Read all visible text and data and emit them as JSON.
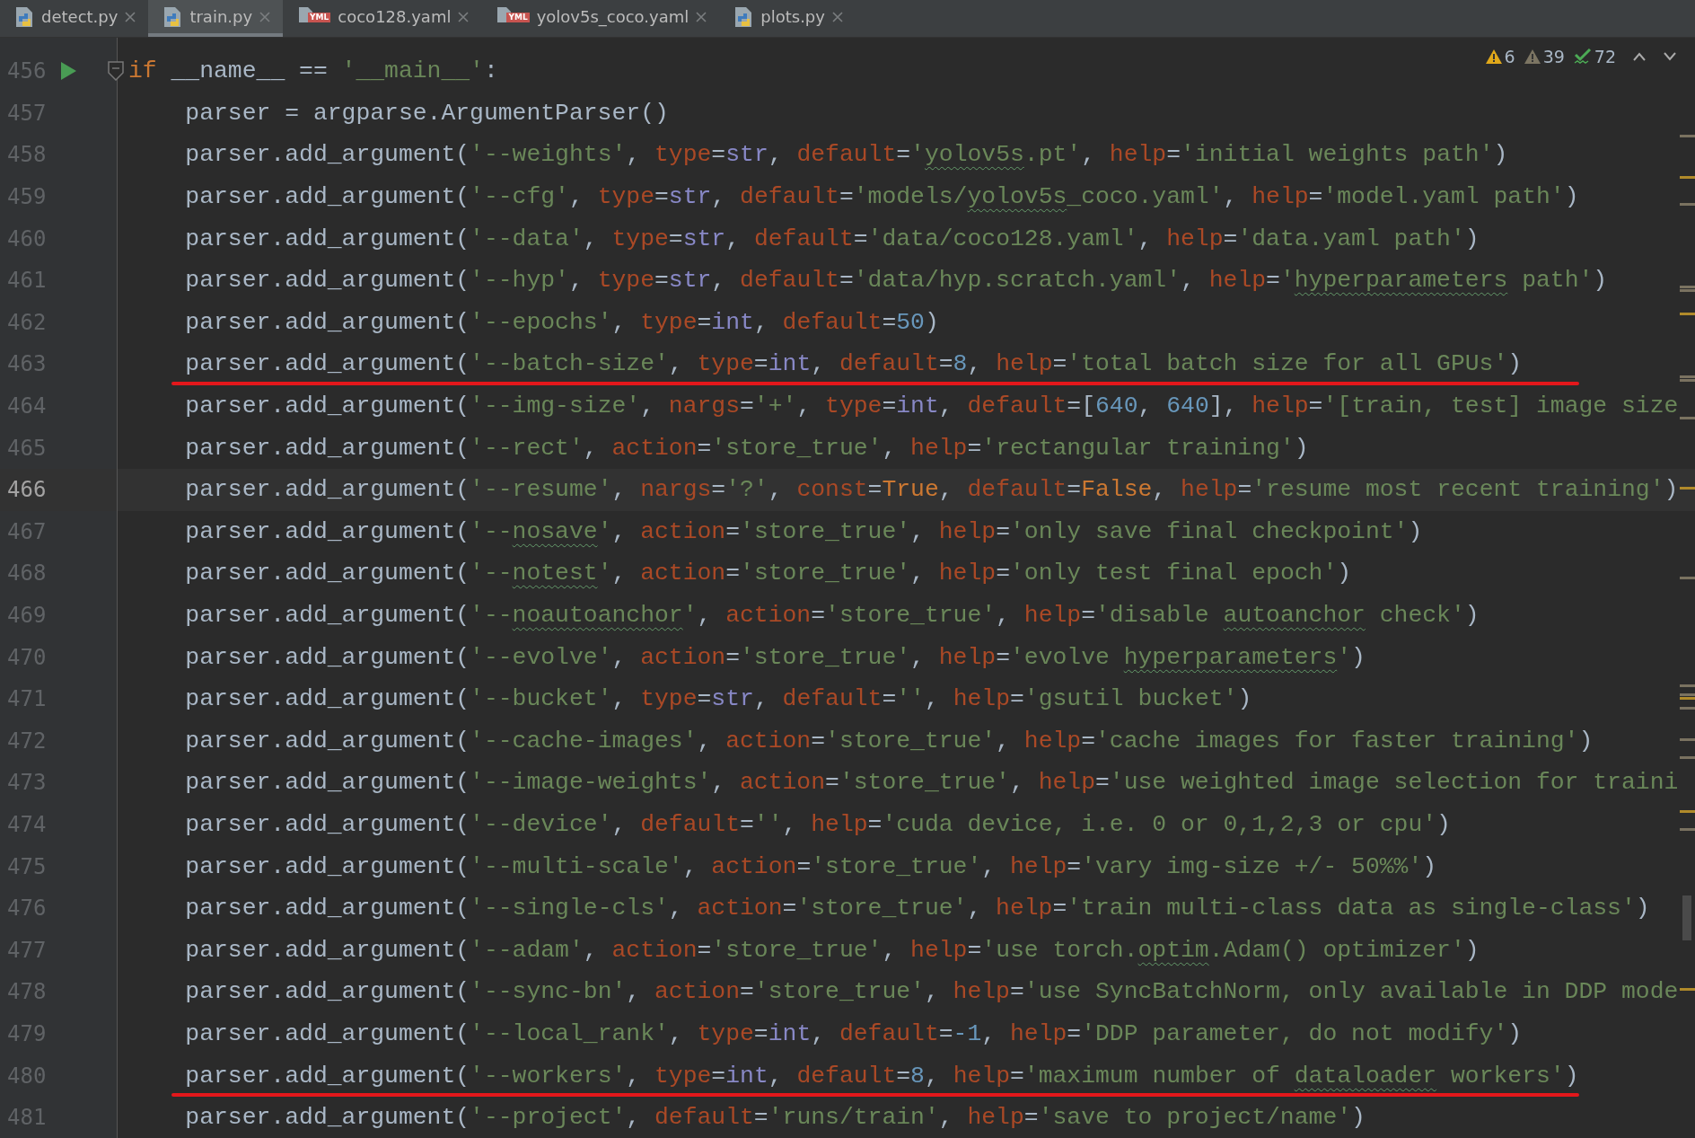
{
  "tabs": [
    {
      "label": "detect.py",
      "kind": "python",
      "selected": false
    },
    {
      "label": "train.py",
      "kind": "python",
      "selected": true
    },
    {
      "label": "coco128.yaml",
      "kind": "yaml",
      "badge": "YML",
      "selected": false
    },
    {
      "label": "yolov5s_coco.yaml",
      "kind": "yaml",
      "badge": "YML",
      "selected": false
    },
    {
      "label": "plots.py",
      "kind": "python",
      "selected": false
    }
  ],
  "inspections": [
    {
      "kind": "warning",
      "count": "6"
    },
    {
      "kind": "weak",
      "count": "39"
    },
    {
      "kind": "typo",
      "count": "72"
    }
  ],
  "lines": [
    {
      "number": "456",
      "run": true,
      "fold": true,
      "tokens": [
        {
          "kind": "k",
          "text": "if"
        },
        {
          "kind": "p",
          "text": " __name__ == "
        },
        {
          "kind": "s",
          "text": "'__main__'"
        },
        {
          "kind": "p",
          "text": ":"
        }
      ]
    },
    {
      "number": "457",
      "tokens": [
        {
          "kind": "p",
          "text": "    parser = argparse.ArgumentParser()"
        }
      ]
    },
    {
      "number": "458",
      "tokens": [
        {
          "kind": "p",
          "text": "    parser.add_argument("
        },
        {
          "kind": "s",
          "text": "'--weights'"
        },
        {
          "kind": "p",
          "text": ", "
        },
        {
          "kind": "a",
          "text": "type"
        },
        {
          "kind": "p",
          "text": "="
        },
        {
          "kind": "b",
          "text": "str"
        },
        {
          "kind": "p",
          "text": ", "
        },
        {
          "kind": "a",
          "text": "default"
        },
        {
          "kind": "p",
          "text": "="
        },
        {
          "kind": "s",
          "text": "'"
        },
        {
          "kind": "s",
          "text": "yolov5s",
          "typo": true
        },
        {
          "kind": "s",
          "text": ".pt'"
        },
        {
          "kind": "p",
          "text": ", "
        },
        {
          "kind": "a",
          "text": "help"
        },
        {
          "kind": "p",
          "text": "="
        },
        {
          "kind": "s",
          "text": "'initial weights path'"
        },
        {
          "kind": "p",
          "text": ")"
        }
      ]
    },
    {
      "number": "459",
      "tokens": [
        {
          "kind": "p",
          "text": "    parser.add_argument("
        },
        {
          "kind": "s",
          "text": "'--cfg'"
        },
        {
          "kind": "p",
          "text": ", "
        },
        {
          "kind": "a",
          "text": "type"
        },
        {
          "kind": "p",
          "text": "="
        },
        {
          "kind": "b",
          "text": "str"
        },
        {
          "kind": "p",
          "text": ", "
        },
        {
          "kind": "a",
          "text": "default"
        },
        {
          "kind": "p",
          "text": "="
        },
        {
          "kind": "s",
          "text": "'models/"
        },
        {
          "kind": "s",
          "text": "yolov5s",
          "typo": true
        },
        {
          "kind": "s",
          "text": "_coco.yaml'"
        },
        {
          "kind": "p",
          "text": ", "
        },
        {
          "kind": "a",
          "text": "help"
        },
        {
          "kind": "p",
          "text": "="
        },
        {
          "kind": "s",
          "text": "'model.yaml path'"
        },
        {
          "kind": "p",
          "text": ")"
        }
      ]
    },
    {
      "number": "460",
      "tokens": [
        {
          "kind": "p",
          "text": "    parser.add_argument("
        },
        {
          "kind": "s",
          "text": "'--data'"
        },
        {
          "kind": "p",
          "text": ", "
        },
        {
          "kind": "a",
          "text": "type"
        },
        {
          "kind": "p",
          "text": "="
        },
        {
          "kind": "b",
          "text": "str"
        },
        {
          "kind": "p",
          "text": ", "
        },
        {
          "kind": "a",
          "text": "default"
        },
        {
          "kind": "p",
          "text": "="
        },
        {
          "kind": "s",
          "text": "'data/coco128.yaml'"
        },
        {
          "kind": "p",
          "text": ", "
        },
        {
          "kind": "a",
          "text": "help"
        },
        {
          "kind": "p",
          "text": "="
        },
        {
          "kind": "s",
          "text": "'data.yaml path'"
        },
        {
          "kind": "p",
          "text": ")"
        }
      ]
    },
    {
      "number": "461",
      "tokens": [
        {
          "kind": "p",
          "text": "    parser.add_argument("
        },
        {
          "kind": "s",
          "text": "'--hyp'"
        },
        {
          "kind": "p",
          "text": ", "
        },
        {
          "kind": "a",
          "text": "type"
        },
        {
          "kind": "p",
          "text": "="
        },
        {
          "kind": "b",
          "text": "str"
        },
        {
          "kind": "p",
          "text": ", "
        },
        {
          "kind": "a",
          "text": "default"
        },
        {
          "kind": "p",
          "text": "="
        },
        {
          "kind": "s",
          "text": "'data/hyp.scratch.yaml'"
        },
        {
          "kind": "p",
          "text": ", "
        },
        {
          "kind": "a",
          "text": "help"
        },
        {
          "kind": "p",
          "text": "="
        },
        {
          "kind": "s",
          "text": "'"
        },
        {
          "kind": "s",
          "text": "hyperparameters",
          "typo": true
        },
        {
          "kind": "s",
          "text": " path'"
        },
        {
          "kind": "p",
          "text": ")"
        }
      ]
    },
    {
      "number": "462",
      "tokens": [
        {
          "kind": "p",
          "text": "    parser.add_argument("
        },
        {
          "kind": "s",
          "text": "'--epochs'"
        },
        {
          "kind": "p",
          "text": ", "
        },
        {
          "kind": "a",
          "text": "type"
        },
        {
          "kind": "p",
          "text": "="
        },
        {
          "kind": "b",
          "text": "int"
        },
        {
          "kind": "p",
          "text": ", "
        },
        {
          "kind": "a",
          "text": "default"
        },
        {
          "kind": "p",
          "text": "="
        },
        {
          "kind": "n",
          "text": "50"
        },
        {
          "kind": "p",
          "text": ")"
        }
      ]
    },
    {
      "number": "463",
      "marked": true,
      "tokens": [
        {
          "kind": "p",
          "text": "    parser.add_argument("
        },
        {
          "kind": "s",
          "text": "'--batch-size'"
        },
        {
          "kind": "p",
          "text": ", "
        },
        {
          "kind": "a",
          "text": "type"
        },
        {
          "kind": "p",
          "text": "="
        },
        {
          "kind": "b",
          "text": "int"
        },
        {
          "kind": "p",
          "text": ", "
        },
        {
          "kind": "a",
          "text": "default"
        },
        {
          "kind": "p",
          "text": "="
        },
        {
          "kind": "n",
          "text": "8"
        },
        {
          "kind": "p",
          "text": ", "
        },
        {
          "kind": "a",
          "text": "help"
        },
        {
          "kind": "p",
          "text": "="
        },
        {
          "kind": "s",
          "text": "'total batch size for all GPUs'"
        },
        {
          "kind": "p",
          "text": ")"
        }
      ]
    },
    {
      "number": "464",
      "tokens": [
        {
          "kind": "p",
          "text": "    parser.add_argument("
        },
        {
          "kind": "s",
          "text": "'--img-size'"
        },
        {
          "kind": "p",
          "text": ", "
        },
        {
          "kind": "a",
          "text": "nargs"
        },
        {
          "kind": "p",
          "text": "="
        },
        {
          "kind": "s",
          "text": "'+'"
        },
        {
          "kind": "p",
          "text": ", "
        },
        {
          "kind": "a",
          "text": "type"
        },
        {
          "kind": "p",
          "text": "="
        },
        {
          "kind": "b",
          "text": "int"
        },
        {
          "kind": "p",
          "text": ", "
        },
        {
          "kind": "a",
          "text": "default"
        },
        {
          "kind": "p",
          "text": "=["
        },
        {
          "kind": "n",
          "text": "640"
        },
        {
          "kind": "p",
          "text": ", "
        },
        {
          "kind": "n",
          "text": "640"
        },
        {
          "kind": "p",
          "text": "], "
        },
        {
          "kind": "a",
          "text": "help"
        },
        {
          "kind": "p",
          "text": "="
        },
        {
          "kind": "s",
          "text": "'[train, test] image size"
        }
      ]
    },
    {
      "number": "465",
      "tokens": [
        {
          "kind": "p",
          "text": "    parser.add_argument("
        },
        {
          "kind": "s",
          "text": "'--rect'"
        },
        {
          "kind": "p",
          "text": ", "
        },
        {
          "kind": "a",
          "text": "action"
        },
        {
          "kind": "p",
          "text": "="
        },
        {
          "kind": "s",
          "text": "'store_true'"
        },
        {
          "kind": "p",
          "text": ", "
        },
        {
          "kind": "a",
          "text": "help"
        },
        {
          "kind": "p",
          "text": "="
        },
        {
          "kind": "s",
          "text": "'rectangular training'"
        },
        {
          "kind": "p",
          "text": ")"
        }
      ]
    },
    {
      "number": "466",
      "current": true,
      "tokens": [
        {
          "kind": "p",
          "text": "    parser.add_argument("
        },
        {
          "kind": "s",
          "text": "'--resume'"
        },
        {
          "kind": "p",
          "text": ", "
        },
        {
          "kind": "a",
          "text": "nargs"
        },
        {
          "kind": "p",
          "text": "="
        },
        {
          "kind": "s",
          "text": "'?'"
        },
        {
          "kind": "p",
          "text": ", "
        },
        {
          "kind": "a",
          "text": "const"
        },
        {
          "kind": "p",
          "text": "="
        },
        {
          "kind": "k",
          "text": "True"
        },
        {
          "kind": "p",
          "text": ", "
        },
        {
          "kind": "a",
          "text": "default"
        },
        {
          "kind": "p",
          "text": "="
        },
        {
          "kind": "k",
          "text": "False"
        },
        {
          "kind": "p",
          "text": ", "
        },
        {
          "kind": "a",
          "text": "help"
        },
        {
          "kind": "p",
          "text": "="
        },
        {
          "kind": "s",
          "text": "'resume most recent training'"
        },
        {
          "kind": "p",
          "text": ")"
        }
      ]
    },
    {
      "number": "467",
      "tokens": [
        {
          "kind": "p",
          "text": "    parser.add_argument("
        },
        {
          "kind": "s",
          "text": "'--"
        },
        {
          "kind": "s",
          "text": "nosave",
          "typo": true
        },
        {
          "kind": "s",
          "text": "'"
        },
        {
          "kind": "p",
          "text": ", "
        },
        {
          "kind": "a",
          "text": "action"
        },
        {
          "kind": "p",
          "text": "="
        },
        {
          "kind": "s",
          "text": "'store_true'"
        },
        {
          "kind": "p",
          "text": ", "
        },
        {
          "kind": "a",
          "text": "help"
        },
        {
          "kind": "p",
          "text": "="
        },
        {
          "kind": "s",
          "text": "'only save final checkpoint'"
        },
        {
          "kind": "p",
          "text": ")"
        }
      ]
    },
    {
      "number": "468",
      "tokens": [
        {
          "kind": "p",
          "text": "    parser.add_argument("
        },
        {
          "kind": "s",
          "text": "'--"
        },
        {
          "kind": "s",
          "text": "notest",
          "typo": true
        },
        {
          "kind": "s",
          "text": "'"
        },
        {
          "kind": "p",
          "text": ", "
        },
        {
          "kind": "a",
          "text": "action"
        },
        {
          "kind": "p",
          "text": "="
        },
        {
          "kind": "s",
          "text": "'store_true'"
        },
        {
          "kind": "p",
          "text": ", "
        },
        {
          "kind": "a",
          "text": "help"
        },
        {
          "kind": "p",
          "text": "="
        },
        {
          "kind": "s",
          "text": "'only test final epoch'"
        },
        {
          "kind": "p",
          "text": ")"
        }
      ]
    },
    {
      "number": "469",
      "tokens": [
        {
          "kind": "p",
          "text": "    parser.add_argument("
        },
        {
          "kind": "s",
          "text": "'--"
        },
        {
          "kind": "s",
          "text": "noautoanchor",
          "typo": true
        },
        {
          "kind": "s",
          "text": "'"
        },
        {
          "kind": "p",
          "text": ", "
        },
        {
          "kind": "a",
          "text": "action"
        },
        {
          "kind": "p",
          "text": "="
        },
        {
          "kind": "s",
          "text": "'store_true'"
        },
        {
          "kind": "p",
          "text": ", "
        },
        {
          "kind": "a",
          "text": "help"
        },
        {
          "kind": "p",
          "text": "="
        },
        {
          "kind": "s",
          "text": "'disable "
        },
        {
          "kind": "s",
          "text": "autoanchor",
          "typo": true
        },
        {
          "kind": "s",
          "text": " check'"
        },
        {
          "kind": "p",
          "text": ")"
        }
      ]
    },
    {
      "number": "470",
      "tokens": [
        {
          "kind": "p",
          "text": "    parser.add_argument("
        },
        {
          "kind": "s",
          "text": "'--evolve'"
        },
        {
          "kind": "p",
          "text": ", "
        },
        {
          "kind": "a",
          "text": "action"
        },
        {
          "kind": "p",
          "text": "="
        },
        {
          "kind": "s",
          "text": "'store_true'"
        },
        {
          "kind": "p",
          "text": ", "
        },
        {
          "kind": "a",
          "text": "help"
        },
        {
          "kind": "p",
          "text": "="
        },
        {
          "kind": "s",
          "text": "'evolve "
        },
        {
          "kind": "s",
          "text": "hyperparameters",
          "typo": true
        },
        {
          "kind": "s",
          "text": "'"
        },
        {
          "kind": "p",
          "text": ")"
        }
      ]
    },
    {
      "number": "471",
      "tokens": [
        {
          "kind": "p",
          "text": "    parser.add_argument("
        },
        {
          "kind": "s",
          "text": "'--bucket'"
        },
        {
          "kind": "p",
          "text": ", "
        },
        {
          "kind": "a",
          "text": "type"
        },
        {
          "kind": "p",
          "text": "="
        },
        {
          "kind": "b",
          "text": "str"
        },
        {
          "kind": "p",
          "text": ", "
        },
        {
          "kind": "a",
          "text": "default"
        },
        {
          "kind": "p",
          "text": "="
        },
        {
          "kind": "s",
          "text": "''"
        },
        {
          "kind": "p",
          "text": ", "
        },
        {
          "kind": "a",
          "text": "help"
        },
        {
          "kind": "p",
          "text": "="
        },
        {
          "kind": "s",
          "text": "'gsutil bucket'"
        },
        {
          "kind": "p",
          "text": ")"
        }
      ]
    },
    {
      "number": "472",
      "tokens": [
        {
          "kind": "p",
          "text": "    parser.add_argument("
        },
        {
          "kind": "s",
          "text": "'--cache-images'"
        },
        {
          "kind": "p",
          "text": ", "
        },
        {
          "kind": "a",
          "text": "action"
        },
        {
          "kind": "p",
          "text": "="
        },
        {
          "kind": "s",
          "text": "'store_true'"
        },
        {
          "kind": "p",
          "text": ", "
        },
        {
          "kind": "a",
          "text": "help"
        },
        {
          "kind": "p",
          "text": "="
        },
        {
          "kind": "s",
          "text": "'cache images for faster training'"
        },
        {
          "kind": "p",
          "text": ")"
        }
      ]
    },
    {
      "number": "473",
      "tokens": [
        {
          "kind": "p",
          "text": "    parser.add_argument("
        },
        {
          "kind": "s",
          "text": "'--image-weights'"
        },
        {
          "kind": "p",
          "text": ", "
        },
        {
          "kind": "a",
          "text": "action"
        },
        {
          "kind": "p",
          "text": "="
        },
        {
          "kind": "s",
          "text": "'store_true'"
        },
        {
          "kind": "p",
          "text": ", "
        },
        {
          "kind": "a",
          "text": "help"
        },
        {
          "kind": "p",
          "text": "="
        },
        {
          "kind": "s",
          "text": "'use weighted image selection for traini"
        }
      ]
    },
    {
      "number": "474",
      "tokens": [
        {
          "kind": "p",
          "text": "    parser.add_argument("
        },
        {
          "kind": "s",
          "text": "'--device'"
        },
        {
          "kind": "p",
          "text": ", "
        },
        {
          "kind": "a",
          "text": "default"
        },
        {
          "kind": "p",
          "text": "="
        },
        {
          "kind": "s",
          "text": "''"
        },
        {
          "kind": "p",
          "text": ", "
        },
        {
          "kind": "a",
          "text": "help"
        },
        {
          "kind": "p",
          "text": "="
        },
        {
          "kind": "s",
          "text": "'cuda device, i.e. 0 or 0,1,2,3 or cpu'"
        },
        {
          "kind": "p",
          "text": ")"
        }
      ]
    },
    {
      "number": "475",
      "tokens": [
        {
          "kind": "p",
          "text": "    parser.add_argument("
        },
        {
          "kind": "s",
          "text": "'--multi-scale'"
        },
        {
          "kind": "p",
          "text": ", "
        },
        {
          "kind": "a",
          "text": "action"
        },
        {
          "kind": "p",
          "text": "="
        },
        {
          "kind": "s",
          "text": "'store_true'"
        },
        {
          "kind": "p",
          "text": ", "
        },
        {
          "kind": "a",
          "text": "help"
        },
        {
          "kind": "p",
          "text": "="
        },
        {
          "kind": "s",
          "text": "'vary img-size +/- 50%%'"
        },
        {
          "kind": "p",
          "text": ")"
        }
      ]
    },
    {
      "number": "476",
      "tokens": [
        {
          "kind": "p",
          "text": "    parser.add_argument("
        },
        {
          "kind": "s",
          "text": "'--single-cls'"
        },
        {
          "kind": "p",
          "text": ", "
        },
        {
          "kind": "a",
          "text": "action"
        },
        {
          "kind": "p",
          "text": "="
        },
        {
          "kind": "s",
          "text": "'store_true'"
        },
        {
          "kind": "p",
          "text": ", "
        },
        {
          "kind": "a",
          "text": "help"
        },
        {
          "kind": "p",
          "text": "="
        },
        {
          "kind": "s",
          "text": "'train multi-class data as single-class'"
        },
        {
          "kind": "p",
          "text": ")"
        }
      ]
    },
    {
      "number": "477",
      "tokens": [
        {
          "kind": "p",
          "text": "    parser.add_argument("
        },
        {
          "kind": "s",
          "text": "'--adam'"
        },
        {
          "kind": "p",
          "text": ", "
        },
        {
          "kind": "a",
          "text": "action"
        },
        {
          "kind": "p",
          "text": "="
        },
        {
          "kind": "s",
          "text": "'store_true'"
        },
        {
          "kind": "p",
          "text": ", "
        },
        {
          "kind": "a",
          "text": "help"
        },
        {
          "kind": "p",
          "text": "="
        },
        {
          "kind": "s",
          "text": "'use torch."
        },
        {
          "kind": "s",
          "text": "optim",
          "typo": true
        },
        {
          "kind": "s",
          "text": ".Adam() optimizer'"
        },
        {
          "kind": "p",
          "text": ")"
        }
      ]
    },
    {
      "number": "478",
      "tokens": [
        {
          "kind": "p",
          "text": "    parser.add_argument("
        },
        {
          "kind": "s",
          "text": "'--sync-bn'"
        },
        {
          "kind": "p",
          "text": ", "
        },
        {
          "kind": "a",
          "text": "action"
        },
        {
          "kind": "p",
          "text": "="
        },
        {
          "kind": "s",
          "text": "'store_true'"
        },
        {
          "kind": "p",
          "text": ", "
        },
        {
          "kind": "a",
          "text": "help"
        },
        {
          "kind": "p",
          "text": "="
        },
        {
          "kind": "s",
          "text": "'use SyncBatchNorm, only available in DDP mode"
        }
      ]
    },
    {
      "number": "479",
      "tokens": [
        {
          "kind": "p",
          "text": "    parser.add_argument("
        },
        {
          "kind": "s",
          "text": "'--local_rank'"
        },
        {
          "kind": "p",
          "text": ", "
        },
        {
          "kind": "a",
          "text": "type"
        },
        {
          "kind": "p",
          "text": "="
        },
        {
          "kind": "b",
          "text": "int"
        },
        {
          "kind": "p",
          "text": ", "
        },
        {
          "kind": "a",
          "text": "default"
        },
        {
          "kind": "p",
          "text": "="
        },
        {
          "kind": "n",
          "text": "-1"
        },
        {
          "kind": "p",
          "text": ", "
        },
        {
          "kind": "a",
          "text": "help"
        },
        {
          "kind": "p",
          "text": "="
        },
        {
          "kind": "s",
          "text": "'DDP parameter, do not modify'"
        },
        {
          "kind": "p",
          "text": ")"
        }
      ]
    },
    {
      "number": "480",
      "marked": true,
      "tokens": [
        {
          "kind": "p",
          "text": "    parser.add_argument("
        },
        {
          "kind": "s",
          "text": "'--workers'"
        },
        {
          "kind": "p",
          "text": ", "
        },
        {
          "kind": "a",
          "text": "type"
        },
        {
          "kind": "p",
          "text": "="
        },
        {
          "kind": "b",
          "text": "int"
        },
        {
          "kind": "p",
          "text": ", "
        },
        {
          "kind": "a",
          "text": "default"
        },
        {
          "kind": "p",
          "text": "="
        },
        {
          "kind": "n",
          "text": "8"
        },
        {
          "kind": "p",
          "text": ", "
        },
        {
          "kind": "a",
          "text": "help"
        },
        {
          "kind": "p",
          "text": "="
        },
        {
          "kind": "s",
          "text": "'maximum number of "
        },
        {
          "kind": "s",
          "text": "dataloader",
          "typo": true
        },
        {
          "kind": "s",
          "text": " workers'"
        },
        {
          "kind": "p",
          "text": ")"
        }
      ]
    },
    {
      "number": "481",
      "tokens": [
        {
          "kind": "p",
          "text": "    parser.add_argument("
        },
        {
          "kind": "s",
          "text": "'--project'"
        },
        {
          "kind": "p",
          "text": ", "
        },
        {
          "kind": "a",
          "text": "default"
        },
        {
          "kind": "p",
          "text": "="
        },
        {
          "kind": "s",
          "text": "'runs/train'"
        },
        {
          "kind": "p",
          "text": ", "
        },
        {
          "kind": "a",
          "text": "help"
        },
        {
          "kind": "p",
          "text": "="
        },
        {
          "kind": "s",
          "text": "'save to project/name'"
        },
        {
          "kind": "p",
          "text": ")"
        }
      ]
    }
  ]
}
